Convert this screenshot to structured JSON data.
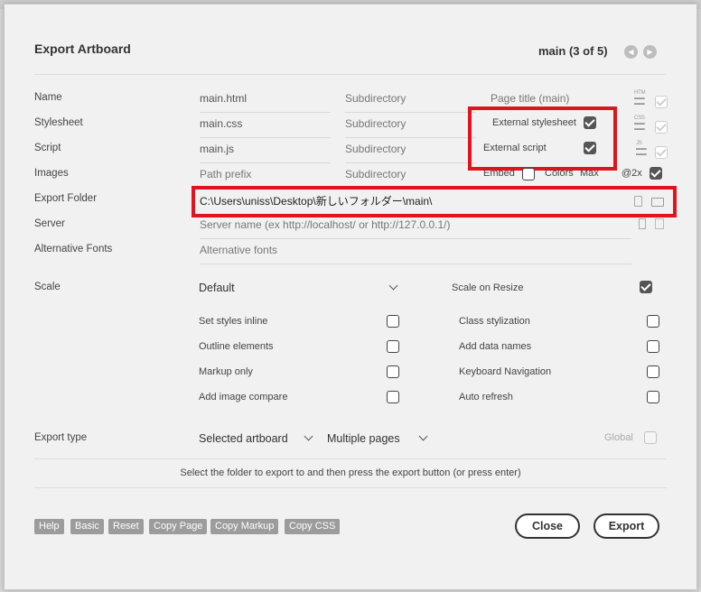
{
  "dialog": {
    "title": "Export Artboard",
    "page_indicator": "main (3 of 5)",
    "prev_label": "◀",
    "next_label": "▶"
  },
  "rows": {
    "name": {
      "label": "Name",
      "value": "main.html",
      "subdir": "Subdirectory",
      "extra": "Page title (main)",
      "icon": "HTM"
    },
    "stylesheet": {
      "label": "Stylesheet",
      "value": "main.css",
      "subdir": "Subdirectory",
      "extra": "External stylesheet",
      "icon": "CSS"
    },
    "script": {
      "label": "Script",
      "value": "main.js",
      "subdir": "Subdirectory",
      "extra": "External script",
      "icon": "JS"
    },
    "images": {
      "label": "Images",
      "value": "Path prefix",
      "subdir": "Subdirectory",
      "embed": "Embed",
      "colors": "Colors",
      "max": "Max",
      "at2x": "@2x"
    },
    "export_folder": {
      "label": "Export Folder",
      "value": "C:\\Users\\uniss\\Desktop\\新しいフォルダー\\main\\"
    },
    "server": {
      "label": "Server",
      "placeholder": "Server name (ex http://localhost/ or http://127.0.0.1/)"
    },
    "alt_fonts": {
      "label": "Alternative Fonts",
      "placeholder": "Alternative fonts"
    }
  },
  "scale": {
    "label": "Scale",
    "value": "Default",
    "resize_label": "Scale on Resize",
    "resize_checked": true
  },
  "options_left": [
    {
      "label": "Set styles inline",
      "checked": false
    },
    {
      "label": "Outline elements",
      "checked": false
    },
    {
      "label": "Markup only",
      "checked": false
    },
    {
      "label": "Add image compare",
      "checked": false
    }
  ],
  "options_right": [
    {
      "label": "Class stylization",
      "checked": false
    },
    {
      "label": "Add data names",
      "checked": false
    },
    {
      "label": "Keyboard Navigation",
      "checked": false
    },
    {
      "label": "Auto refresh",
      "checked": false
    }
  ],
  "export_type": {
    "label": "Export type",
    "value": "Selected artboard",
    "pages_value": "Multiple pages",
    "global_label": "Global"
  },
  "note": "Select the folder to export to and then press the export button (or press enter)",
  "footer": {
    "buttons": [
      "Help",
      "Basic",
      "Reset",
      "Copy Page",
      "Copy Markup",
      "Copy CSS"
    ],
    "close": "Close",
    "export": "Export"
  },
  "colors": {
    "highlight": "#e0141e",
    "checked": "#555555"
  },
  "icons": [
    "chevron-left-icon",
    "chevron-right-icon",
    "html-file-icon",
    "css-file-icon",
    "js-file-icon",
    "clipboard-icon",
    "folder-icon",
    "server-icon",
    "chevron-down-icon"
  ]
}
